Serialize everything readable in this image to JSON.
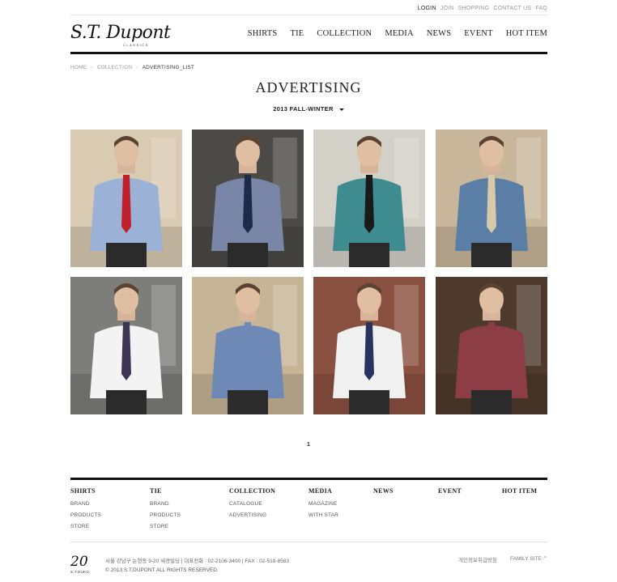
{
  "util_nav": [
    "LOGIN",
    "JOIN",
    "SHOPPING",
    "CONTACT US",
    "FAQ"
  ],
  "brand": {
    "logo": "S.T. Dupont",
    "sub": "CLASSICS"
  },
  "gnb": [
    "SHIRTS",
    "TIE",
    "COLLECTION",
    "MEDIA",
    "NEWS",
    "EVENT",
    "HOT ITEM"
  ],
  "breadcrumb": [
    "HOME",
    "COLLECTION",
    "ADVERTISING_LIST"
  ],
  "page_title": "ADVERTISING",
  "season": "2013 FALL-WINTER",
  "gallery": [
    {
      "icon": "photo-model-light-blue-shirt-red-tie",
      "shirt": "#9bb2d6",
      "tie": "#c0202b",
      "bg": "#d9cbb2"
    },
    {
      "icon": "photo-model-striped-shirt-navy-tie",
      "shirt": "#7a86a8",
      "tie": "#1d2a4a",
      "bg": "#4c4a47"
    },
    {
      "icon": "photo-model-teal-shirt-bowtie",
      "shirt": "#3e8b90",
      "tie": "#1a1a1a",
      "bg": "#d3d0c8"
    },
    {
      "icon": "photo-model-denim-shirt-scarf",
      "shirt": "#5a7ea6",
      "tie": "#d8c9aa",
      "bg": "#c8b69a"
    },
    {
      "icon": "photo-model-white-shirt-striped-tie",
      "shirt": "#f3f3f3",
      "tie": "#3b3553",
      "bg": "#7d7e7a"
    },
    {
      "icon": "photo-model-blue-shirt",
      "shirt": "#6f89b6",
      "tie": "#6f89b6",
      "bg": "#c6b496"
    },
    {
      "icon": "photo-model-white-shirt-navy-tie",
      "shirt": "#f0f0f0",
      "tie": "#2a3360",
      "bg": "#8a5040"
    },
    {
      "icon": "photo-model-burgundy-shirt",
      "shirt": "#8c3d45",
      "tie": "#8c3d45",
      "bg": "#4e3a2c"
    }
  ],
  "pager": "1",
  "footer_cols": [
    {
      "title": "SHIRTS",
      "items": [
        "BRAND",
        "PRODUCTS",
        "STORE"
      ]
    },
    {
      "title": "TIE",
      "items": [
        "BRAND",
        "PRODUCTS",
        "STORE"
      ]
    },
    {
      "title": "COLLECTION",
      "items": [
        "CATALOGUE",
        "ADVERTISING"
      ]
    },
    {
      "title": "MEDIA",
      "items": [
        "MAGAZINE",
        "WITH STAR"
      ]
    },
    {
      "title": "NEWS",
      "items": []
    },
    {
      "title": "EVENT",
      "items": []
    },
    {
      "title": "HOT ITEM",
      "items": []
    }
  ],
  "footer": {
    "badge": "20",
    "badge_sub": "S.T.DUKO",
    "address": "서울 강남구 논현동 9-20 세경빌딩  |  대표전화 : 02-2106-3400  |  FAX : 02-518-8583",
    "copyright": "© 2013 S.T.DUPONT ALL RIGHTS RESERVED.",
    "privacy": "개인정보취급방침",
    "family_site": "FAMILY SITE ⌃"
  }
}
